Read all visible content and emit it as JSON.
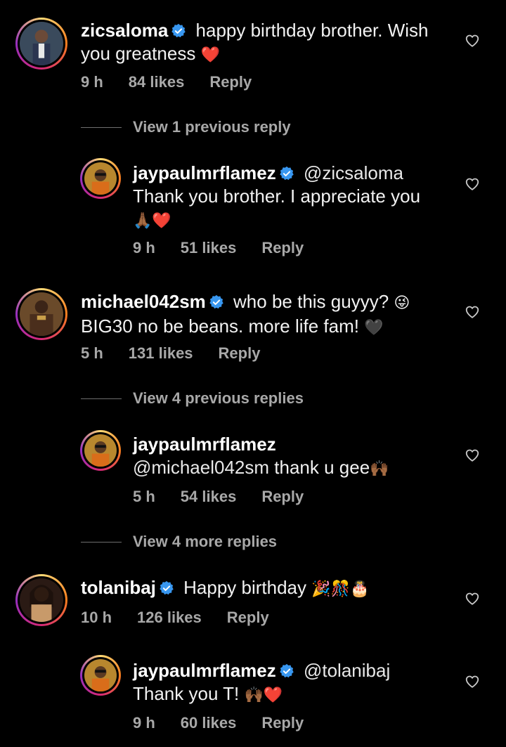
{
  "colors": {
    "accent_verified": "#3897f0",
    "muted": "#a8a8a8",
    "text": "#f2f2f2",
    "heart": "#e0245e"
  },
  "comments": [
    {
      "username": "zicsaloma",
      "text_line1": "happy birthday brother. Wish",
      "text_line2": "you greatness",
      "emoji": "❤️",
      "time": "9 h",
      "likes": "84 likes",
      "reply": "Reply"
    },
    {
      "username": "jaypaulmrflamez",
      "mention": "@zicsaloma",
      "text_line2": "Thank you brother. I appreciate you",
      "emoji": "🙏🏾❤️",
      "time": "9 h",
      "likes": "51 likes",
      "reply": "Reply"
    },
    {
      "username": "michael042sm",
      "text_line1": "who be this guyyy?",
      "emoji1": "😜",
      "text_line2": "BIG30 no be beans. more life fam!",
      "emoji2": "🖤",
      "time": "5 h",
      "likes": "131 likes",
      "reply": "Reply"
    },
    {
      "username": "jaypaulmrflamez",
      "mention": "@michael042sm",
      "text_line2": "thank u gee",
      "emoji": "🙌🏾",
      "time": "5 h",
      "likes": "54 likes",
      "reply": "Reply"
    },
    {
      "username": "tolanibaj",
      "text_line1": "Happy birthday",
      "emoji": "🎉🎊🎂",
      "time": "10 h",
      "likes": "126 likes",
      "reply": "Reply"
    },
    {
      "username": "jaypaulmrflamez",
      "mention": "@tolanibaj",
      "text_line2": "Thank you T!",
      "emoji": "🙌🏾❤️",
      "time": "9 h",
      "likes": "60 likes",
      "reply": "Reply"
    }
  ],
  "view_replies": [
    "View 1 previous reply",
    "View 4 previous replies",
    "View 4 more replies"
  ]
}
